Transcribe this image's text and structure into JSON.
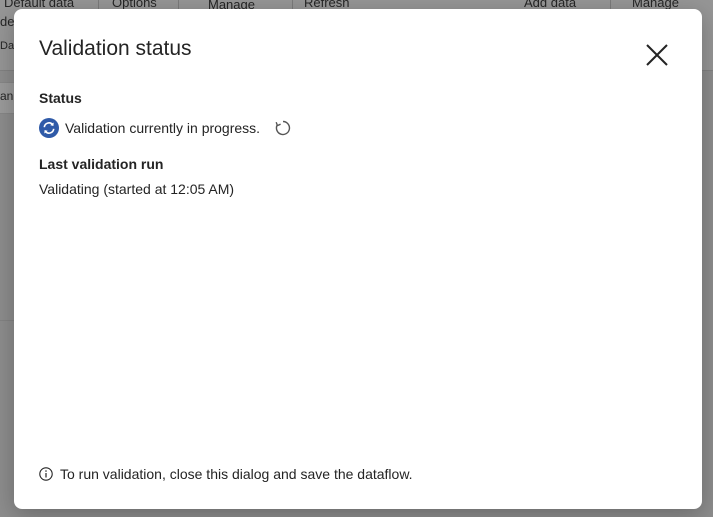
{
  "background": {
    "ribbon_items": [
      "Default data",
      "Options",
      "Manage",
      "Refresh",
      "Add data",
      "Manage"
    ],
    "row2_fragment": "de",
    "row3_fragment": "Da",
    "side_fragment": "an"
  },
  "dialog": {
    "title": "Validation status",
    "status_heading": "Status",
    "status_text": "Validation currently in progress.",
    "last_run_heading": "Last validation run",
    "last_run_text": "Validating (started at 12:05 AM)",
    "footer_text": "To run validation, close this dialog and save the dataflow."
  },
  "colors": {
    "accent": "#2f5aa8",
    "text": "#242424"
  },
  "icons": {
    "status": "sync-icon",
    "spinner": "refresh-spinner-icon",
    "close": "close-icon",
    "info": "info-icon"
  }
}
